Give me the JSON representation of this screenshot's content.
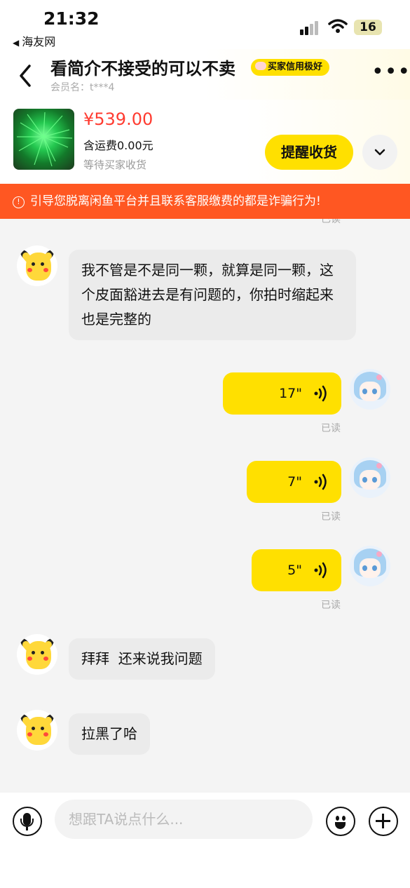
{
  "status_bar": {
    "time": "21:32",
    "back_app": "海友网",
    "battery": "16"
  },
  "header": {
    "title": "看简介不接受的可以不卖",
    "badge": "买家信用极好",
    "member": "会员名：t***4"
  },
  "order": {
    "price": "¥539.00",
    "shipping": "含运费0.00元",
    "status": "等待买家收货",
    "remind_label": "提醒收货"
  },
  "warning": {
    "text": "引导您脱离闲鱼平台并且联系客服缴费的都是诈骗行为!"
  },
  "chat": {
    "top_read": "已读",
    "messages": [
      {
        "side": "in",
        "type": "text",
        "text": "我不管是不是同一颗，就算是同一颗，这个皮面豁进去是有问题的，你拍时缩起来也是完整的"
      },
      {
        "side": "out",
        "type": "voice",
        "duration": "17\"",
        "read": "已读"
      },
      {
        "side": "out",
        "type": "voice",
        "duration": "7\"",
        "read": "已读"
      },
      {
        "side": "out",
        "type": "voice",
        "duration": "5\"",
        "read": "已读"
      },
      {
        "side": "in",
        "type": "text",
        "text": "拜拜  还来说我问题"
      },
      {
        "side": "in",
        "type": "text",
        "text": "拉黑了哈"
      }
    ]
  },
  "input": {
    "placeholder": "想跟TA说点什么..."
  },
  "colors": {
    "accent": "#ffe000",
    "warning_bg": "#ff5722",
    "price": "#ff3b30"
  }
}
